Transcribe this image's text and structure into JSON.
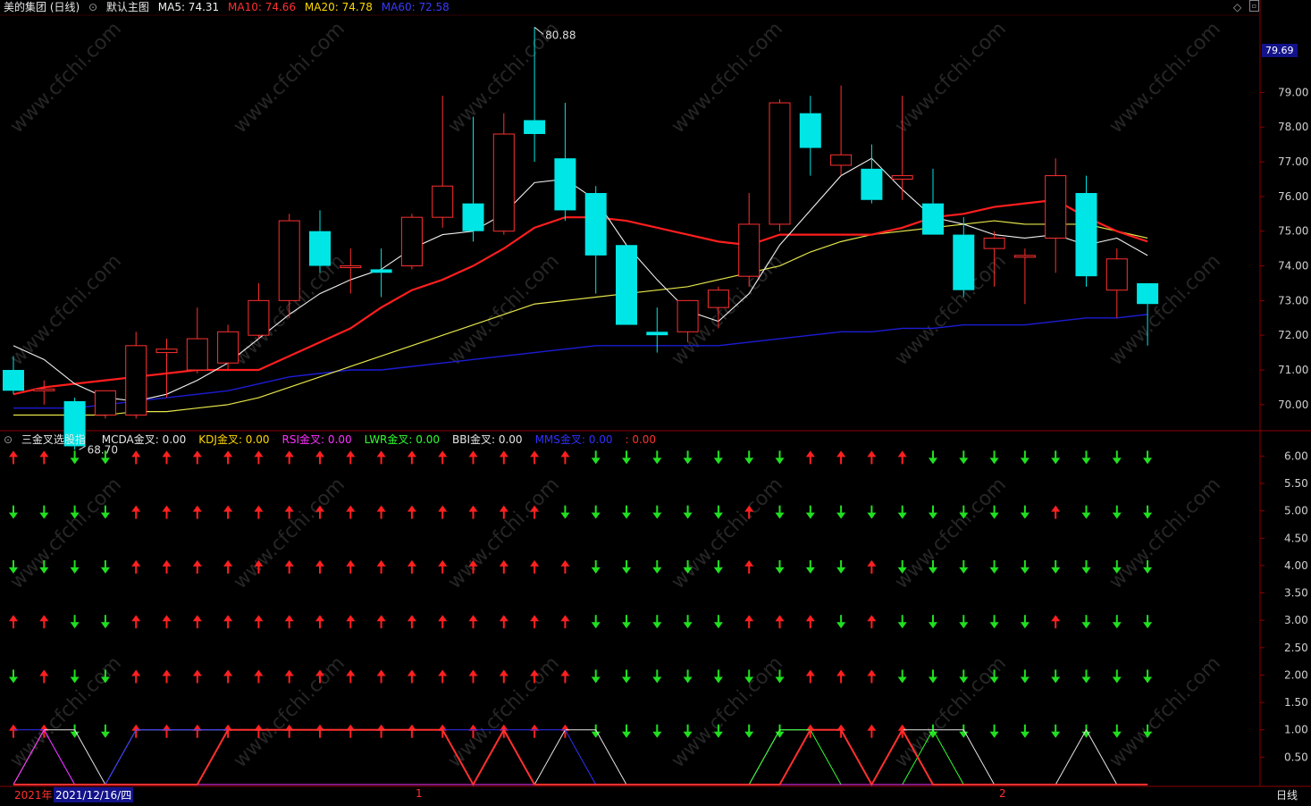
{
  "header": {
    "stock_name": "美的集团 (日线)",
    "main_chart_label": "默认主图",
    "ma5_label": "MA5: 74.31",
    "ma10_label": "MA10: 74.66",
    "ma20_label": "MA20: 74.78",
    "ma60_label": "MA60: 72.58"
  },
  "price_badge": "79.69",
  "indicator_header": {
    "name": "三金叉选股指",
    "items": [
      {
        "label": "MCDA金叉: 0.00",
        "color": "#e6e6e6"
      },
      {
        "label": "KDJ金叉: 0.00",
        "color": "#ffd700"
      },
      {
        "label": "RSI金叉: 0.00",
        "color": "#ff30ff"
      },
      {
        "label": "LWR金叉: 0.00",
        "color": "#30ff30"
      },
      {
        "label": "BBI金叉: 0.00",
        "color": "#e6e6e6"
      },
      {
        "label": "MMS金叉: 0.00",
        "color": "#3030ff"
      },
      {
        "label": ": 0.00",
        "color": "#ff3030"
      }
    ]
  },
  "annotations": {
    "high_label": "80.88",
    "low_label": "68.70"
  },
  "footer": {
    "year_label": "2021年",
    "date_label": "2021/12/16/四",
    "month_1": "1",
    "month_2": "2",
    "period_button": "日线"
  },
  "colors": {
    "up": "#ff3030",
    "down": "#00e5e5",
    "ma5": "#f0f0f0",
    "ma10": "#ff1e1e",
    "ma20": "#e6e64a",
    "ma60": "#1c1cd6",
    "grid": "#8a0000",
    "arrow_up": "#ff2020",
    "arrow_down": "#20e020"
  },
  "chart_data": [
    {
      "type": "candlestick",
      "title": "美的集团 (日线)",
      "ylim": [
        69.3,
        81.2
      ],
      "y_ticks": [
        "70.00",
        "71.00",
        "72.00",
        "73.00",
        "74.00",
        "75.00",
        "76.00",
        "77.00",
        "78.00",
        "79.00"
      ],
      "candles": [
        {
          "o": 71.0,
          "h": 71.4,
          "l": 70.3,
          "c": 70.4
        },
        {
          "o": 70.4,
          "h": 70.7,
          "l": 70.0,
          "c": 70.45
        },
        {
          "o": 70.1,
          "h": 70.2,
          "l": 68.7,
          "c": 68.8
        },
        {
          "o": 69.7,
          "h": 70.4,
          "l": 69.6,
          "c": 70.4
        },
        {
          "o": 69.7,
          "h": 72.1,
          "l": 69.6,
          "c": 71.7
        },
        {
          "o": 71.5,
          "h": 71.9,
          "l": 70.2,
          "c": 71.6
        },
        {
          "o": 71.0,
          "h": 72.8,
          "l": 70.9,
          "c": 71.9
        },
        {
          "o": 71.2,
          "h": 72.3,
          "l": 71.0,
          "c": 72.1
        },
        {
          "o": 72.0,
          "h": 73.5,
          "l": 71.9,
          "c": 73.0
        },
        {
          "o": 73.0,
          "h": 75.5,
          "l": 72.5,
          "c": 75.3
        },
        {
          "o": 75.0,
          "h": 75.6,
          "l": 73.8,
          "c": 74.0
        },
        {
          "o": 74.0,
          "h": 74.5,
          "l": 73.2,
          "c": 74.0
        },
        {
          "o": 73.9,
          "h": 74.5,
          "l": 73.1,
          "c": 73.8
        },
        {
          "o": 74.0,
          "h": 75.5,
          "l": 73.9,
          "c": 75.4
        },
        {
          "o": 75.4,
          "h": 78.9,
          "l": 75.1,
          "c": 76.3
        },
        {
          "o": 75.8,
          "h": 78.3,
          "l": 74.7,
          "c": 75.0
        },
        {
          "o": 75.0,
          "h": 78.4,
          "l": 74.9,
          "c": 77.8
        },
        {
          "o": 78.2,
          "h": 80.88,
          "l": 77.0,
          "c": 77.8
        },
        {
          "o": 77.1,
          "h": 78.7,
          "l": 75.3,
          "c": 75.6
        },
        {
          "o": 76.1,
          "h": 76.3,
          "l": 73.2,
          "c": 74.3
        },
        {
          "o": 74.6,
          "h": 74.6,
          "l": 72.3,
          "c": 72.3
        },
        {
          "o": 72.1,
          "h": 72.8,
          "l": 71.5,
          "c": 72.0
        },
        {
          "o": 72.1,
          "h": 73.0,
          "l": 71.8,
          "c": 73.0
        },
        {
          "o": 72.8,
          "h": 73.4,
          "l": 72.2,
          "c": 73.3
        },
        {
          "o": 73.7,
          "h": 76.1,
          "l": 73.4,
          "c": 75.2
        },
        {
          "o": 75.2,
          "h": 78.8,
          "l": 75.0,
          "c": 78.7
        },
        {
          "o": 78.4,
          "h": 78.9,
          "l": 76.6,
          "c": 77.4
        },
        {
          "o": 76.9,
          "h": 79.2,
          "l": 76.6,
          "c": 77.2
        },
        {
          "o": 76.8,
          "h": 77.5,
          "l": 75.8,
          "c": 75.9
        },
        {
          "o": 76.5,
          "h": 78.9,
          "l": 75.9,
          "c": 76.6
        },
        {
          "o": 75.8,
          "h": 76.8,
          "l": 74.9,
          "c": 74.9
        },
        {
          "o": 74.9,
          "h": 75.4,
          "l": 73.1,
          "c": 73.3
        },
        {
          "o": 74.5,
          "h": 75.0,
          "l": 73.4,
          "c": 74.8
        },
        {
          "o": 74.3,
          "h": 74.5,
          "l": 72.9,
          "c": 74.3
        },
        {
          "o": 74.8,
          "h": 77.1,
          "l": 73.8,
          "c": 76.6
        },
        {
          "o": 76.1,
          "h": 76.6,
          "l": 73.4,
          "c": 73.7
        },
        {
          "o": 73.3,
          "h": 74.5,
          "l": 72.5,
          "c": 74.2
        },
        {
          "o": 73.5,
          "h": 73.5,
          "l": 71.7,
          "c": 72.9
        }
      ],
      "ma5": [
        71.7,
        71.3,
        70.6,
        70.2,
        70.1,
        70.3,
        70.7,
        71.2,
        71.9,
        72.6,
        73.2,
        73.6,
        73.9,
        74.5,
        74.9,
        75.0,
        75.5,
        76.4,
        76.5,
        75.9,
        74.6,
        73.6,
        72.7,
        72.4,
        73.2,
        74.6,
        75.6,
        76.6,
        77.1,
        76.2,
        75.4,
        75.2,
        74.9,
        74.8,
        74.9,
        74.6,
        74.8,
        74.3
      ],
      "ma10": [
        70.3,
        70.5,
        70.6,
        70.7,
        70.8,
        70.9,
        71.0,
        71.0,
        71.0,
        71.4,
        71.8,
        72.2,
        72.8,
        73.3,
        73.6,
        74.0,
        74.5,
        75.1,
        75.4,
        75.4,
        75.3,
        75.1,
        74.9,
        74.7,
        74.6,
        74.9,
        74.9,
        74.9,
        74.9,
        75.1,
        75.4,
        75.5,
        75.7,
        75.8,
        75.9,
        75.4,
        75.0,
        74.7
      ],
      "ma20": [
        69.7,
        69.7,
        69.7,
        69.7,
        69.8,
        69.8,
        69.9,
        70.0,
        70.2,
        70.5,
        70.8,
        71.1,
        71.4,
        71.7,
        72.0,
        72.3,
        72.6,
        72.9,
        73.0,
        73.1,
        73.2,
        73.3,
        73.4,
        73.6,
        73.8,
        74.0,
        74.4,
        74.7,
        74.9,
        75.0,
        75.1,
        75.2,
        75.3,
        75.2,
        75.2,
        75.2,
        75.0,
        74.8
      ],
      "ma60": [
        69.9,
        69.9,
        69.9,
        70.0,
        70.1,
        70.2,
        70.3,
        70.4,
        70.6,
        70.8,
        70.9,
        71.0,
        71.0,
        71.1,
        71.2,
        71.3,
        71.4,
        71.5,
        71.6,
        71.7,
        71.7,
        71.7,
        71.7,
        71.7,
        71.8,
        71.9,
        72.0,
        72.1,
        72.1,
        72.2,
        72.2,
        72.3,
        72.3,
        72.3,
        72.4,
        72.5,
        72.5,
        72.6
      ]
    },
    {
      "type": "indicator",
      "title": "三金叉选股指",
      "ylim": [
        0,
        6.3
      ],
      "y_ticks": [
        "0.50",
        "1.00",
        "1.50",
        "2.00",
        "2.50",
        "3.00",
        "3.50",
        "4.00",
        "4.50",
        "5.00",
        "5.50",
        "6.00"
      ],
      "arrow_rows": [
        {
          "level": 6,
          "signals": [
            1,
            1,
            0,
            0,
            1,
            1,
            1,
            1,
            1,
            1,
            1,
            1,
            1,
            1,
            1,
            1,
            1,
            1,
            1,
            0,
            0,
            0,
            0,
            0,
            0,
            0,
            1,
            1,
            1,
            1,
            0,
            0,
            0,
            0,
            0,
            0,
            0,
            0
          ]
        },
        {
          "level": 5,
          "signals": [
            0,
            0,
            0,
            0,
            1,
            1,
            1,
            1,
            1,
            1,
            1,
            1,
            1,
            1,
            1,
            1,
            1,
            1,
            0,
            0,
            0,
            0,
            0,
            0,
            1,
            0,
            0,
            0,
            0,
            0,
            0,
            0,
            0,
            0,
            1,
            0,
            0,
            0
          ]
        },
        {
          "level": 4,
          "signals": [
            0,
            0,
            0,
            0,
            1,
            1,
            1,
            1,
            1,
            1,
            1,
            1,
            1,
            1,
            1,
            1,
            1,
            1,
            1,
            0,
            0,
            0,
            0,
            0,
            1,
            0,
            0,
            0,
            1,
            0,
            0,
            0,
            0,
            0,
            0,
            0,
            0,
            0
          ]
        },
        {
          "level": 3,
          "signals": [
            1,
            1,
            0,
            0,
            1,
            1,
            1,
            1,
            1,
            1,
            1,
            1,
            1,
            1,
            1,
            1,
            1,
            1,
            1,
            0,
            0,
            0,
            0,
            0,
            1,
            1,
            1,
            0,
            1,
            0,
            0,
            0,
            0,
            0,
            1,
            0,
            0,
            0
          ]
        },
        {
          "level": 2,
          "signals": [
            0,
            1,
            0,
            0,
            1,
            1,
            1,
            1,
            1,
            1,
            1,
            1,
            1,
            1,
            1,
            1,
            1,
            1,
            1,
            0,
            0,
            0,
            0,
            0,
            0,
            0,
            1,
            1,
            1,
            0,
            0,
            0,
            0,
            0,
            0,
            0,
            0,
            0
          ]
        },
        {
          "level": 1,
          "signals": [
            1,
            1,
            0,
            0,
            1,
            1,
            1,
            1,
            1,
            1,
            1,
            1,
            1,
            1,
            1,
            1,
            1,
            1,
            1,
            0,
            0,
            0,
            0,
            0,
            0,
            0,
            1,
            1,
            1,
            1,
            0,
            0,
            0,
            0,
            0,
            0,
            0,
            0
          ]
        }
      ],
      "series": [
        {
          "name": "MCDA金叉",
          "color": "#e6e6e6",
          "values": [
            0,
            1,
            1,
            0,
            1,
            1,
            1,
            1,
            1,
            1,
            1,
            1,
            1,
            1,
            1,
            0,
            1,
            0,
            1,
            1,
            0,
            0,
            0,
            0,
            0,
            1,
            1,
            1,
            0,
            1,
            1,
            1,
            0,
            0,
            0,
            1,
            0,
            0
          ]
        },
        {
          "name": "LWR金叉",
          "color": "#30ff30",
          "values": [
            0,
            0,
            0,
            0,
            0,
            0,
            0,
            0,
            0,
            0,
            0,
            0,
            0,
            0,
            0,
            0,
            0,
            0,
            0,
            0,
            0,
            0,
            0,
            0,
            0,
            1,
            1,
            0,
            0,
            0,
            1,
            0,
            0,
            0,
            0,
            0,
            0,
            0
          ]
        },
        {
          "name": "MMS金叉",
          "color": "#3030ff",
          "values": [
            1,
            1,
            0,
            0,
            1,
            1,
            1,
            1,
            1,
            1,
            1,
            1,
            1,
            1,
            1,
            1,
            1,
            1,
            1,
            0,
            0,
            0,
            0,
            0,
            0,
            0,
            0,
            0,
            0,
            1,
            0,
            0,
            0,
            0,
            0,
            0,
            0,
            0
          ]
        },
        {
          "name": "RSI金叉",
          "color": "#ff30ff",
          "values": [
            0,
            1,
            0,
            0,
            0,
            0,
            0,
            0,
            0,
            0,
            0,
            0,
            0,
            0,
            0,
            0,
            0,
            0,
            0,
            0,
            0,
            0,
            0,
            0,
            0,
            0,
            0,
            0,
            0,
            0,
            0,
            0,
            0,
            0,
            0,
            0,
            0,
            0
          ]
        },
        {
          "name": ": 0.00",
          "color": "#ff3030",
          "values": [
            0,
            0,
            0,
            0,
            0,
            0,
            0,
            1,
            1,
            1,
            1,
            1,
            1,
            1,
            1,
            0,
            1,
            0,
            0,
            0,
            0,
            0,
            0,
            0,
            0,
            0,
            1,
            1,
            0,
            1,
            0,
            0,
            0,
            0,
            0,
            0,
            0,
            0
          ]
        }
      ]
    }
  ]
}
